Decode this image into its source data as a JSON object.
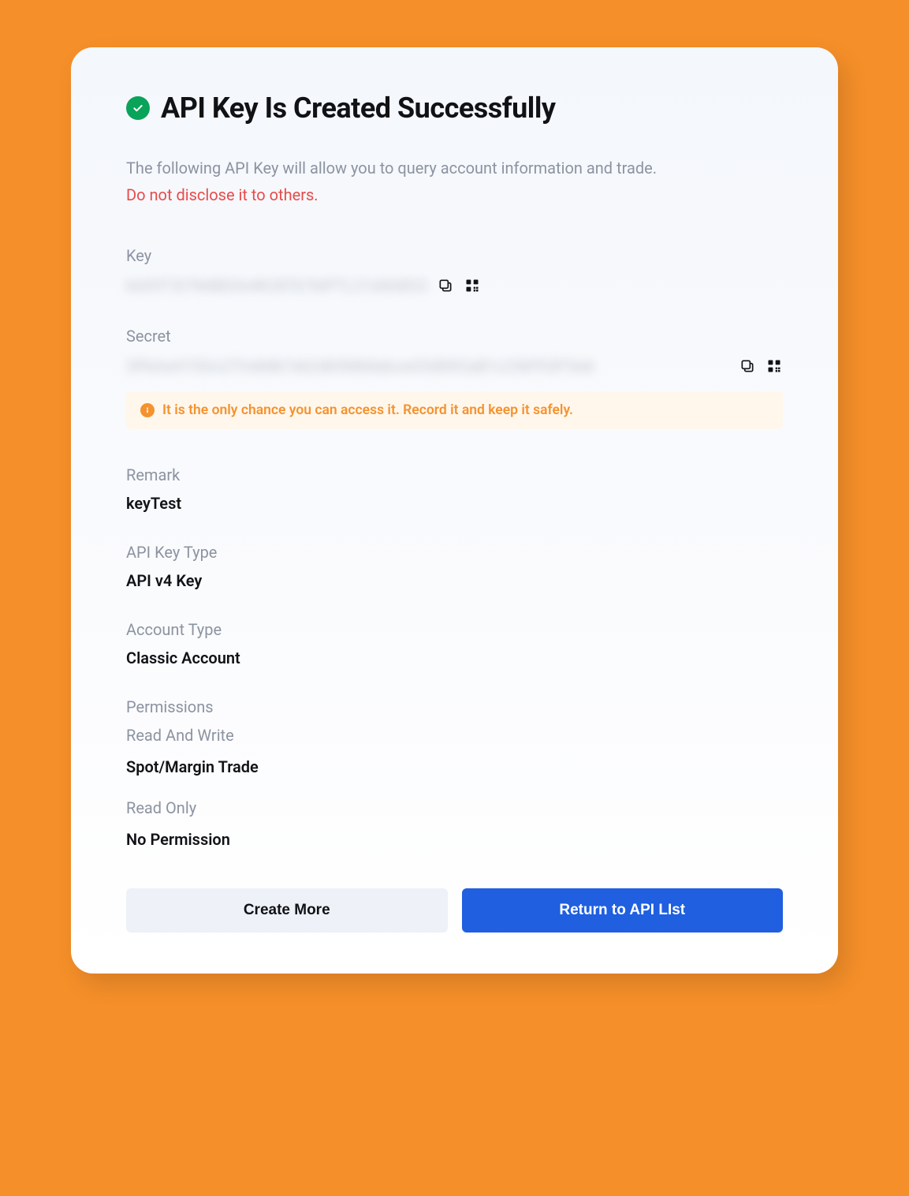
{
  "title": "API Key Is Created Successfully",
  "description": "The following API Key will allow you to query account information and trade.",
  "disclose_warning": "Do not disclose it to others.",
  "key": {
    "label": "Key",
    "value_masked": "k6X9T3t7N4B03x4K28Tk7bIPTL21d4A8O3"
  },
  "secret": {
    "label": "Secret",
    "value_masked": "3PkAwH7iDm2TmkMk7eb2dk9Mk8abcw03dN92aB1c23kP03F5wk"
  },
  "notice": "It is the only chance you can access it. Record it and keep it safely.",
  "remark": {
    "label": "Remark",
    "value": "keyTest"
  },
  "api_key_type": {
    "label": "API Key Type",
    "value": "API v4 Key"
  },
  "account_type": {
    "label": "Account Type",
    "value": "Classic Account"
  },
  "permissions": {
    "label": "Permissions",
    "read_write_label": "Read And Write",
    "read_write_value": "Spot/Margin Trade",
    "read_only_label": "Read Only",
    "read_only_value": "No Permission"
  },
  "buttons": {
    "create_more": "Create More",
    "return": "Return to API LIst"
  }
}
